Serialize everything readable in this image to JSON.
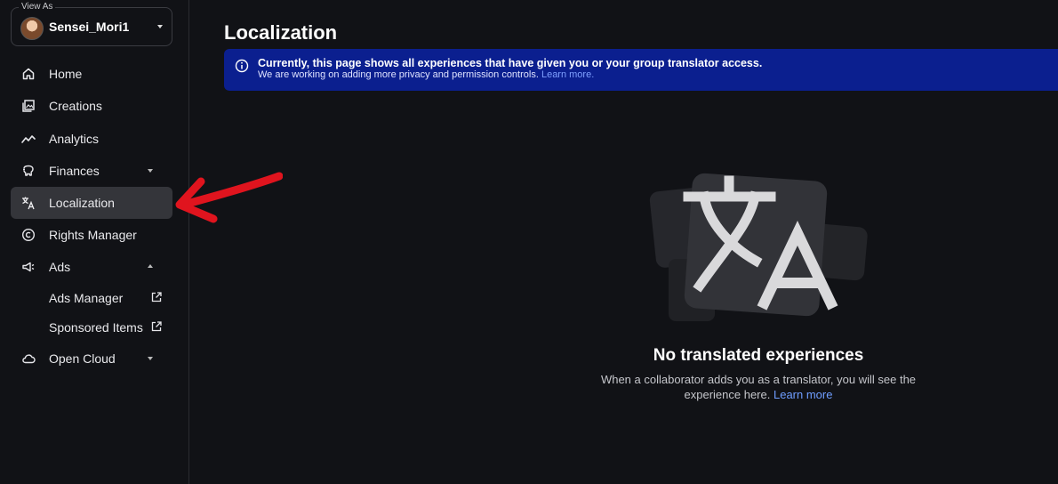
{
  "sidebar": {
    "view_as_label": "View As",
    "user_name": "Sensei_Mori1",
    "items": [
      {
        "label": "Home",
        "icon": "home-icon"
      },
      {
        "label": "Creations",
        "icon": "creations-icon"
      },
      {
        "label": "Analytics",
        "icon": "analytics-icon"
      },
      {
        "label": "Finances",
        "icon": "finances-icon"
      },
      {
        "label": "Localization",
        "icon": "translate-icon"
      },
      {
        "label": "Rights Manager",
        "icon": "copyright-icon"
      },
      {
        "label": "Ads",
        "icon": "megaphone-icon"
      },
      {
        "label": "Ads Manager",
        "icon": "external-link-icon"
      },
      {
        "label": "Sponsored Items",
        "icon": "external-link-icon"
      },
      {
        "label": "Open Cloud",
        "icon": "cloud-icon"
      }
    ],
    "active_item": "Localization"
  },
  "main": {
    "title": "Localization",
    "banner": {
      "title": "Currently, this page shows all experiences that have given you or your group translator access.",
      "subtitle": "We are working on adding more privacy and permission controls.",
      "link": "Learn more."
    },
    "empty_state": {
      "title": "No translated experiences",
      "text_line1": "When a collaborator adds you as a translator, you will see the",
      "text_line2": "experience here.",
      "link": "Learn more"
    }
  },
  "colors": {
    "background": "#111216",
    "active_item_bg": "#34353a",
    "banner_bg": "#0b1f8f",
    "link": "#6f9dff",
    "annotation_arrow": "#e0141e"
  }
}
